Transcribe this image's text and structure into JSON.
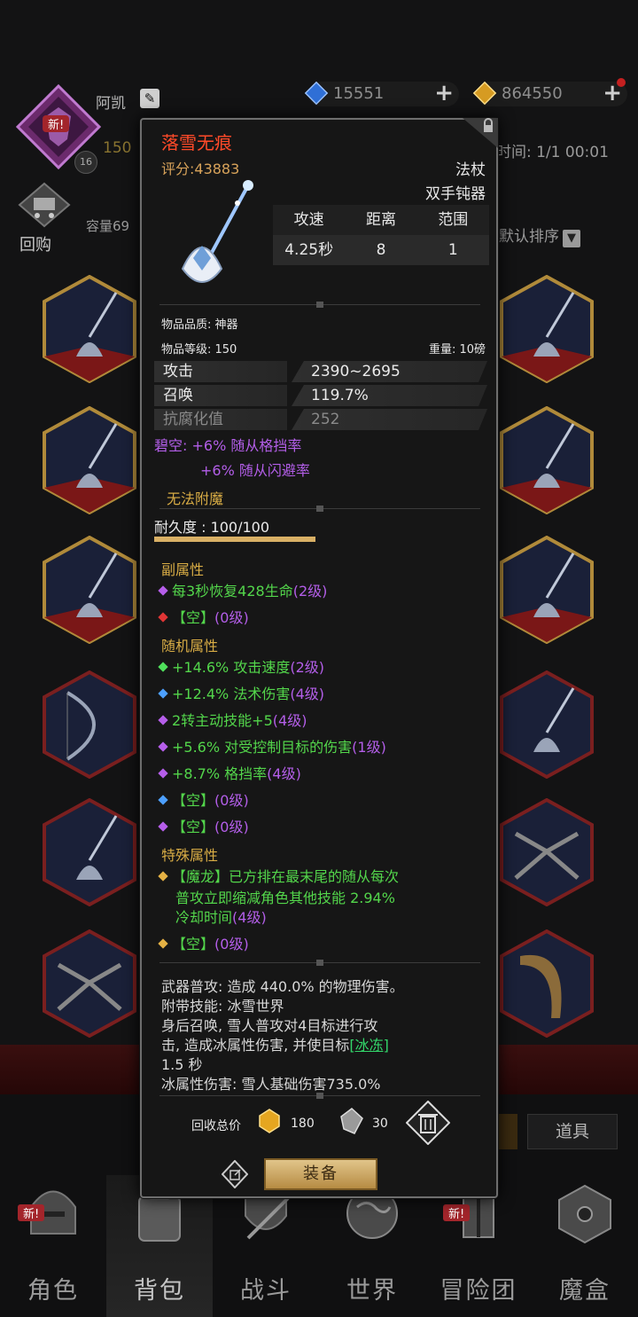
{
  "header": {
    "player_name": "阿凯",
    "avatar_badge": "新!",
    "avatar_level": "16",
    "level_text": "150",
    "gems": "15551",
    "gold": "864550",
    "time_text": "时间: 1/1 00:01"
  },
  "inventory": {
    "buyback_label": "回购",
    "capacity_label": "容量69",
    "sort_label": "默认排序"
  },
  "item": {
    "name": "落雪无痕",
    "score": "评分:43883",
    "type": "法杖",
    "subtype": "双手钝器",
    "spec_headers": [
      "攻速",
      "距离",
      "范围"
    ],
    "spec_values": [
      "4.25秒",
      "8",
      "1"
    ],
    "quality": "物品品质: 神器",
    "item_level": "物品等级: 150",
    "weight": "重量: 10磅",
    "stats": [
      {
        "key": "攻击",
        "value": "2390~2695"
      },
      {
        "key": "召唤",
        "value": "119.7%"
      },
      {
        "key": "抗腐化值",
        "value": "252"
      }
    ],
    "set_bonus_1": "碧空: +6% 随从格挡率",
    "set_bonus_2": "+6% 随从闪避率",
    "no_enchant": "无法附魔",
    "durability_label": "耐久度 : 100/100",
    "durability_fraction": 1.0,
    "sub_attr_title": "副属性",
    "sub_attrs": [
      {
        "text": "每3秒恢复428生命",
        "level": "(2级)"
      },
      {
        "text": "【空】",
        "level": "(0级)"
      }
    ],
    "random_attr_title": "随机属性",
    "random_attrs": [
      {
        "text": "+14.6% 攻击速度",
        "level": "(2级)"
      },
      {
        "text": "+12.4% 法术伤害",
        "level": "(4级)"
      },
      {
        "text": "2转主动技能+5",
        "level": "(4级)"
      },
      {
        "text": "+5.6% 对受控制目标的伤害",
        "level": "(1级)"
      },
      {
        "text": "+8.7% 格挡率",
        "level": "(4级)"
      },
      {
        "text": "【空】",
        "level": "(0级)"
      },
      {
        "text": "【空】",
        "level": "(0级)"
      }
    ],
    "special_attr_title": "特殊属性",
    "special_line1": "【魔龙】已方排在最末尾的随从每次",
    "special_line2": "普攻立即缩减角色其他技能 2.94%",
    "special_line3": "冷却时间",
    "special_line3_level": "(4级)",
    "special_empty": "【空】",
    "special_empty_level": "(0级)",
    "desc_line1": "武器普攻: 造成 440.0% 的物理伤害。",
    "desc_line2": "附带技能: 冰雪世界",
    "desc_line3": "身后召唤, 雪人普攻对4目标进行攻",
    "desc_line4a": "击, 造成冰属性伤害, 并使目标",
    "desc_link": "[冰冻]",
    "desc_line5": "1.5 秒",
    "desc_line6": "冰属性伤害: 雪人基础伤害735.0%",
    "recycle_label": "回收总价",
    "recycle_gold": "180",
    "recycle_material": "30",
    "equip_label": "装备"
  },
  "tool_button": "道具",
  "nav": [
    {
      "label": "角色",
      "badge": "新!"
    },
    {
      "label": "背包"
    },
    {
      "label": "战斗"
    },
    {
      "label": "世界"
    },
    {
      "label": "冒险团",
      "badge": "新!"
    },
    {
      "label": "魔盒"
    }
  ],
  "colors": {
    "item_name": "#ff4a29",
    "score": "#d8a35a",
    "set_bonus": "#b35ee8",
    "section_title": "#d8ac45",
    "green_stat": "#53d64b"
  }
}
